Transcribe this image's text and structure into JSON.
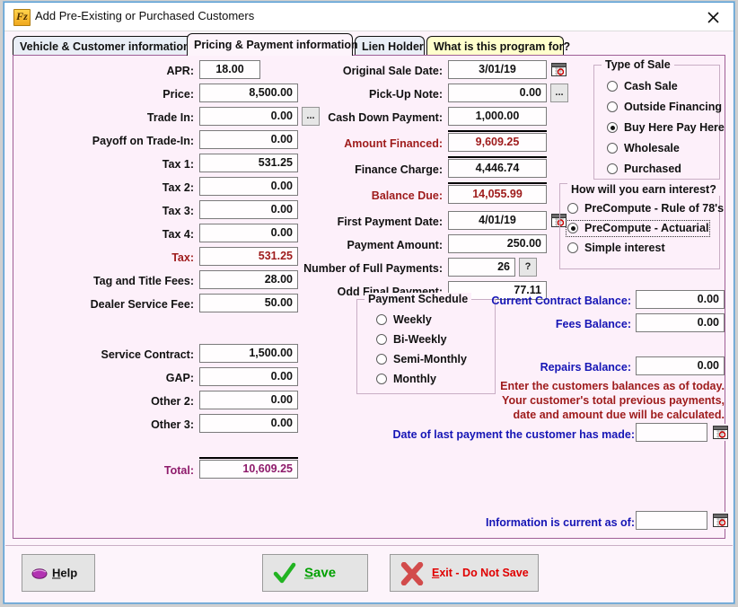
{
  "window": {
    "title": "Add Pre-Existing or Purchased Customers",
    "icon": "app-icon",
    "icon_glyph": "Fz",
    "close_glyph": "✕"
  },
  "tabs": [
    {
      "label": "Vehicle & Customer information",
      "active": false,
      "style": "normal"
    },
    {
      "label": "Pricing & Payment information",
      "active": true,
      "style": "normal"
    },
    {
      "label": "Lien Holder",
      "active": false,
      "style": "normal"
    },
    {
      "label": "What is this program for?",
      "active": false,
      "style": "yellow"
    }
  ],
  "left_column": {
    "fields": [
      {
        "label": "APR:",
        "value": "18.00",
        "align": "center"
      },
      {
        "label": "Price:",
        "value": "8,500.00"
      },
      {
        "label": "Trade In:",
        "value": "0.00",
        "ellipsis_button": "..."
      },
      {
        "label": "Payoff on Trade-In:",
        "value": "0.00"
      },
      {
        "label": "Tax 1:",
        "value": "531.25"
      },
      {
        "label": "Tax 2:",
        "value": "0.00"
      },
      {
        "label": "Tax 3:",
        "value": "0.00"
      },
      {
        "label": "Tax 4:",
        "value": "0.00"
      },
      {
        "label": "Tax:",
        "value": "531.25",
        "color": "red"
      },
      {
        "label": "Tag and Title Fees:",
        "value": "28.00"
      },
      {
        "label": "Dealer Service Fee:",
        "value": "50.00"
      },
      {
        "label": "Service Contract:",
        "value": "1,500.00"
      },
      {
        "label": "GAP:",
        "value": "0.00"
      },
      {
        "label": "Other 2:",
        "value": "0.00"
      },
      {
        "label": "Other 3:",
        "value": "0.00"
      },
      {
        "label": "Total:",
        "value": "10,609.25",
        "color": "purple"
      }
    ]
  },
  "middle_column": {
    "fields": [
      {
        "label": "Original Sale Date:",
        "value": "3/01/19",
        "calendar": true
      },
      {
        "label": "Pick-Up Note:",
        "value": "0.00",
        "ellipsis_button": "..."
      },
      {
        "label": "Cash Down Payment:",
        "value": "1,000.00"
      },
      {
        "label": "Amount Financed:",
        "value": "9,609.25",
        "color": "red"
      },
      {
        "label": "Finance Charge:",
        "value": "4,446.74"
      },
      {
        "label": "Balance Due:",
        "value": "14,055.99",
        "color": "red"
      },
      {
        "label": "First Payment Date:",
        "value": "4/01/19",
        "calendar": true
      },
      {
        "label": "Payment Amount:",
        "value": "250.00"
      },
      {
        "label": "Number of Full Payments:",
        "value": "26",
        "help_button": "?"
      },
      {
        "label": "Odd Final Payment:",
        "value": "77.11"
      }
    ]
  },
  "payment_schedule": {
    "title": "Payment Schedule",
    "options": [
      "Weekly",
      "Bi-Weekly",
      "Semi-Monthly",
      "Monthly"
    ],
    "selected": null
  },
  "type_of_sale": {
    "title": "Type of Sale",
    "options": [
      "Cash Sale",
      "Outside Financing",
      "Buy Here Pay Here",
      "Wholesale",
      "Purchased"
    ],
    "selected": "Buy Here Pay Here"
  },
  "interest_method": {
    "title": "How will you earn interest?",
    "options": [
      "PreCompute - Rule of 78's",
      "PreCompute - Actuarial",
      "Simple interest"
    ],
    "selected": "PreCompute - Actuarial"
  },
  "balances": {
    "fields": [
      {
        "label": "Current Contract Balance:",
        "value": "0.00"
      },
      {
        "label": "Fees Balance:",
        "value": "0.00"
      },
      {
        "label": "Repairs Balance:",
        "value": "0.00"
      }
    ],
    "note_line1": "Enter the customers balances as of today.",
    "note_line2": "Your customer's total previous payments,",
    "note_line3": "date and amount due will be calculated.",
    "last_payment_label": "Date of last payment the customer has made:",
    "last_payment_value": "",
    "current_as_of_label": "Information is current as of:",
    "current_as_of_value": ""
  },
  "buttons": {
    "help": {
      "label": "Help",
      "accel": "H",
      "icon": "book-icon"
    },
    "save": {
      "label": "Save",
      "accel": "S",
      "icon": "check-icon"
    },
    "exit": {
      "label": "Exit - Do Not Save",
      "accel": "E",
      "icon": "x-icon"
    }
  },
  "colors": {
    "panel_bg": "#fdf0fa",
    "red_label": "#9e1b1b",
    "blue_label": "#1515b5",
    "purple_value": "#8e1b6b",
    "save_green": "#00a000",
    "exit_red": "#e00000",
    "tab_yellow": "#ffffcc"
  }
}
